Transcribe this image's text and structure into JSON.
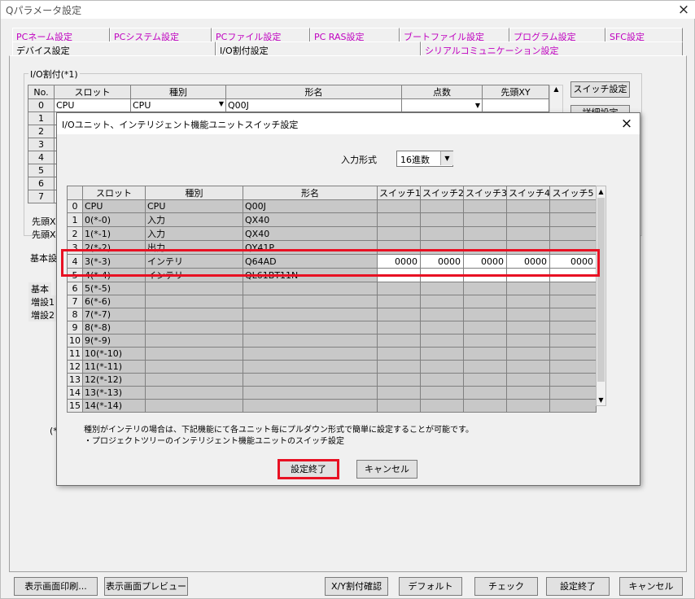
{
  "window": {
    "title": "Qパラメータ設定",
    "close": "×"
  },
  "tabs_row1": [
    "PCネーム設定",
    "PCシステム設定",
    "PCファイル設定",
    "PC RAS設定",
    "ブートファイル設定",
    "プログラム設定",
    "SFC設定"
  ],
  "tabs_row2": [
    "デバイス設定",
    "I/O割付設定",
    "シリアルコミュニケーション設定"
  ],
  "io_group": {
    "label": "I/O割付(*1)",
    "headers": [
      "No.",
      "スロット",
      "種別",
      "形名",
      "点数",
      "先頭XY"
    ],
    "rows": [
      {
        "no": "0",
        "slot": "CPU",
        "type": "CPU",
        "model": "Q00J",
        "points": "",
        "start": ""
      },
      {
        "no": "1",
        "slot": "",
        "type": "",
        "model": "",
        "points": "",
        "start": ""
      },
      {
        "no": "2",
        "slot": "",
        "type": "",
        "model": "",
        "points": "",
        "start": ""
      },
      {
        "no": "3",
        "slot": "",
        "type": "",
        "model": "",
        "points": "",
        "start": ""
      },
      {
        "no": "4",
        "slot": "",
        "type": "",
        "model": "",
        "points": "",
        "start": ""
      },
      {
        "no": "5",
        "slot": "",
        "type": "",
        "model": "",
        "points": "",
        "start": ""
      },
      {
        "no": "6",
        "slot": "",
        "type": "",
        "model": "",
        "points": "",
        "start": ""
      },
      {
        "no": "7",
        "slot": "",
        "type": "",
        "model": "",
        "points": "",
        "start": ""
      }
    ],
    "switch_button": "スイッチ設定",
    "detail_button": "詳細設定"
  },
  "left_fragments": [
    "先頭X",
    "先頭X",
    "基本設",
    "基本",
    "増設1",
    "増設2",
    "(*"
  ],
  "bottom_buttons": [
    "表示画面印刷...",
    "表示画面プレビュー",
    "X/Y割付確認",
    "デフォルト",
    "チェック",
    "設定終了",
    "キャンセル"
  ],
  "dialog": {
    "title": "I/Oユニット、インテリジェント機能ユニットスイッチ設定",
    "close": "×",
    "input_format_label": "入力形式",
    "input_format_value": "16進数",
    "headers": [
      "",
      "スロット",
      "種別",
      "形名",
      "スイッチ1",
      "スイッチ2",
      "スイッチ3",
      "スイッチ4",
      "スイッチ5"
    ],
    "rows": [
      {
        "no": "0",
        "slot": "CPU",
        "type": "CPU",
        "model": "Q00J",
        "sw": [
          "",
          "",
          "",
          "",
          ""
        ]
      },
      {
        "no": "1",
        "slot": "0(*-0)",
        "type": "入力",
        "model": "QX40",
        "sw": [
          "",
          "",
          "",
          "",
          ""
        ]
      },
      {
        "no": "2",
        "slot": "1(*-1)",
        "type": "入力",
        "model": "QX40",
        "sw": [
          "",
          "",
          "",
          "",
          ""
        ]
      },
      {
        "no": "3",
        "slot": "2(*-2)",
        "type": "出力",
        "model": "QY41P",
        "sw": [
          "",
          "",
          "",
          "",
          ""
        ]
      },
      {
        "no": "4",
        "slot": "3(*-3)",
        "type": "インテリ",
        "model": "Q64AD",
        "sw": [
          "0000",
          "0000",
          "0000",
          "0000",
          "0000"
        ]
      },
      {
        "no": "5",
        "slot": "4(*-4)",
        "type": "インテリ",
        "model": "QL61BT11N",
        "sw": [
          "",
          "",
          "",
          "",
          ""
        ]
      },
      {
        "no": "6",
        "slot": "5(*-5)",
        "type": "",
        "model": "",
        "sw": [
          "",
          "",
          "",
          "",
          ""
        ]
      },
      {
        "no": "7",
        "slot": "6(*-6)",
        "type": "",
        "model": "",
        "sw": [
          "",
          "",
          "",
          "",
          ""
        ]
      },
      {
        "no": "8",
        "slot": "7(*-7)",
        "type": "",
        "model": "",
        "sw": [
          "",
          "",
          "",
          "",
          ""
        ]
      },
      {
        "no": "9",
        "slot": "8(*-8)",
        "type": "",
        "model": "",
        "sw": [
          "",
          "",
          "",
          "",
          ""
        ]
      },
      {
        "no": "10",
        "slot": "9(*-9)",
        "type": "",
        "model": "",
        "sw": [
          "",
          "",
          "",
          "",
          ""
        ]
      },
      {
        "no": "11",
        "slot": "10(*-10)",
        "type": "",
        "model": "",
        "sw": [
          "",
          "",
          "",
          "",
          ""
        ]
      },
      {
        "no": "12",
        "slot": "11(*-11)",
        "type": "",
        "model": "",
        "sw": [
          "",
          "",
          "",
          "",
          ""
        ]
      },
      {
        "no": "13",
        "slot": "12(*-12)",
        "type": "",
        "model": "",
        "sw": [
          "",
          "",
          "",
          "",
          ""
        ]
      },
      {
        "no": "14",
        "slot": "13(*-13)",
        "type": "",
        "model": "",
        "sw": [
          "",
          "",
          "",
          "",
          ""
        ]
      },
      {
        "no": "15",
        "slot": "14(*-14)",
        "type": "",
        "model": "",
        "sw": [
          "",
          "",
          "",
          "",
          ""
        ]
      }
    ],
    "note1": "種別がインテリの場合は、下記機能にて各ユニット毎にプルダウン形式で簡単に設定することが可能です。",
    "note2": "・プロジェクトツリーのインテリジェント機能ユニットのスイッチ設定",
    "ok_button": "設定終了",
    "cancel_button": "キャンセル"
  },
  "colors": {
    "highlight": "#e81123",
    "tab_text": "#c000c0"
  }
}
